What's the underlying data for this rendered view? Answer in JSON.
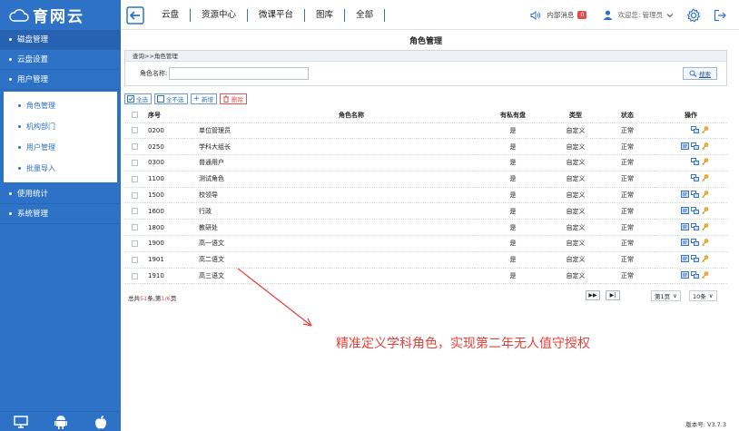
{
  "app": {
    "logo_text": "育网云"
  },
  "nav": {
    "items": [
      "云盘",
      "资源中心",
      "微课平台",
      "图库",
      "全部"
    ]
  },
  "header": {
    "messages_label": "内部消息",
    "messages_count": "0",
    "welcome": "欢迎您:",
    "username": "管理员"
  },
  "sidebar": {
    "groups": [
      "磁盘管理",
      "云盘设置",
      "用户管理",
      "使用统计",
      "系统管理"
    ],
    "user_sub_items": [
      "角色管理",
      "机构部门",
      "用户管理",
      "批量导入"
    ]
  },
  "page": {
    "title": "角色管理",
    "breadcrumb": "查询>>角色管理",
    "search_label": "角色名称:",
    "search_value": "",
    "search_button": "搜索"
  },
  "toolbar": {
    "select_all": "全选",
    "deselect_all": "全不选",
    "add": "新增",
    "delete": "删除"
  },
  "table": {
    "headers": [
      "序号",
      "角色名称",
      "有私有盘",
      "类型",
      "状态",
      "操作"
    ],
    "rows": [
      {
        "seq": "0200",
        "name": "单位管理员",
        "private": "是",
        "type": "自定义",
        "status": "正常",
        "ops": 2
      },
      {
        "seq": "0250",
        "name": "学科大组长",
        "private": "是",
        "type": "自定义",
        "status": "正常",
        "ops": 3
      },
      {
        "seq": "0300",
        "name": "普通用户",
        "private": "是",
        "type": "自定义",
        "status": "正常",
        "ops": 2
      },
      {
        "seq": "1100",
        "name": "测试角色",
        "private": "是",
        "type": "自定义",
        "status": "正常",
        "ops": 2
      },
      {
        "seq": "1500",
        "name": "校领导",
        "private": "是",
        "type": "自定义",
        "status": "正常",
        "ops": 3
      },
      {
        "seq": "1600",
        "name": "行政",
        "private": "是",
        "type": "自定义",
        "status": "正常",
        "ops": 3
      },
      {
        "seq": "1800",
        "name": "教研处",
        "private": "是",
        "type": "自定义",
        "status": "正常",
        "ops": 3
      },
      {
        "seq": "1900",
        "name": "高一语文",
        "private": "是",
        "type": "自定义",
        "status": "正常",
        "ops": 3
      },
      {
        "seq": "1901",
        "name": "高二语文",
        "private": "是",
        "type": "自定义",
        "status": "正常",
        "ops": 3
      },
      {
        "seq": "1910",
        "name": "高三语文",
        "private": "是",
        "type": "自定义",
        "status": "正常",
        "ops": 3
      }
    ]
  },
  "pager": {
    "total_prefix": "总共",
    "total_count": "51",
    "total_mid": "条,第",
    "page_info": "1/6",
    "total_suffix": "页",
    "next": "▶▶",
    "last": "▶|",
    "page_select": "第1页",
    "size_select": "10条"
  },
  "annotation": "精准定义学科角色，实现第二年无人值守授权",
  "footer": {
    "version": "版本号: V3.7.3"
  },
  "colors": {
    "primary": "#2d72c7",
    "accent_red": "#e8403a"
  }
}
